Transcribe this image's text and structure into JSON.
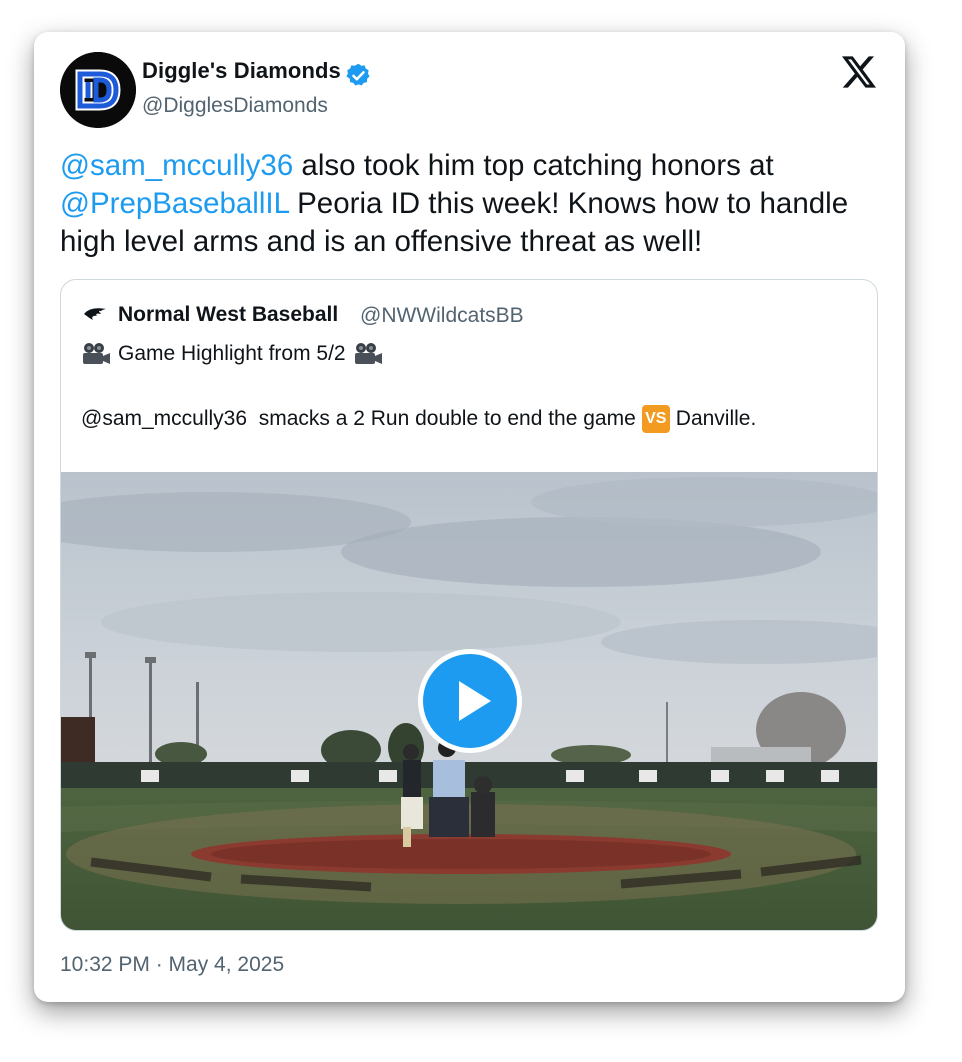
{
  "author": {
    "name": "Diggle's Diamonds",
    "handle": "@DigglesDiamonds",
    "verified": true,
    "avatar_icon": "dd-monogram-logo",
    "avatar_colors": {
      "background": "#0a0a0a",
      "monogram": "#1e5bd8"
    }
  },
  "platform_icon": "x-logo",
  "tweet": {
    "mention1": "@sam_mccully36",
    "text1": " also took him top catching honors at ",
    "mention2": "@PrepBaseballIL",
    "text2": " Peoria ID this week! Knows how to handle high level arms and is an offensive threat as well!"
  },
  "quoted_tweet": {
    "icon": "wildcat-icon",
    "name": "Normal West Baseball",
    "handle": "@NWWildcatsBB",
    "line1": "Game Highlight from 5/2",
    "line1_icon": "movie-camera-icon",
    "line2_before": "@sam_mccully36  smacks a 2 Run double to end the game",
    "line2_badge": "VS",
    "line2_after": "Danville.",
    "media": {
      "type": "video",
      "play_icon": "play-icon"
    }
  },
  "timestamp": "10:32 PM · May 4, 2025",
  "colors": {
    "link": "#1d9bf0",
    "text": "#0f1419",
    "muted": "#536471",
    "verified": "#1d9bf0",
    "vs_badge": "#f39b20"
  }
}
